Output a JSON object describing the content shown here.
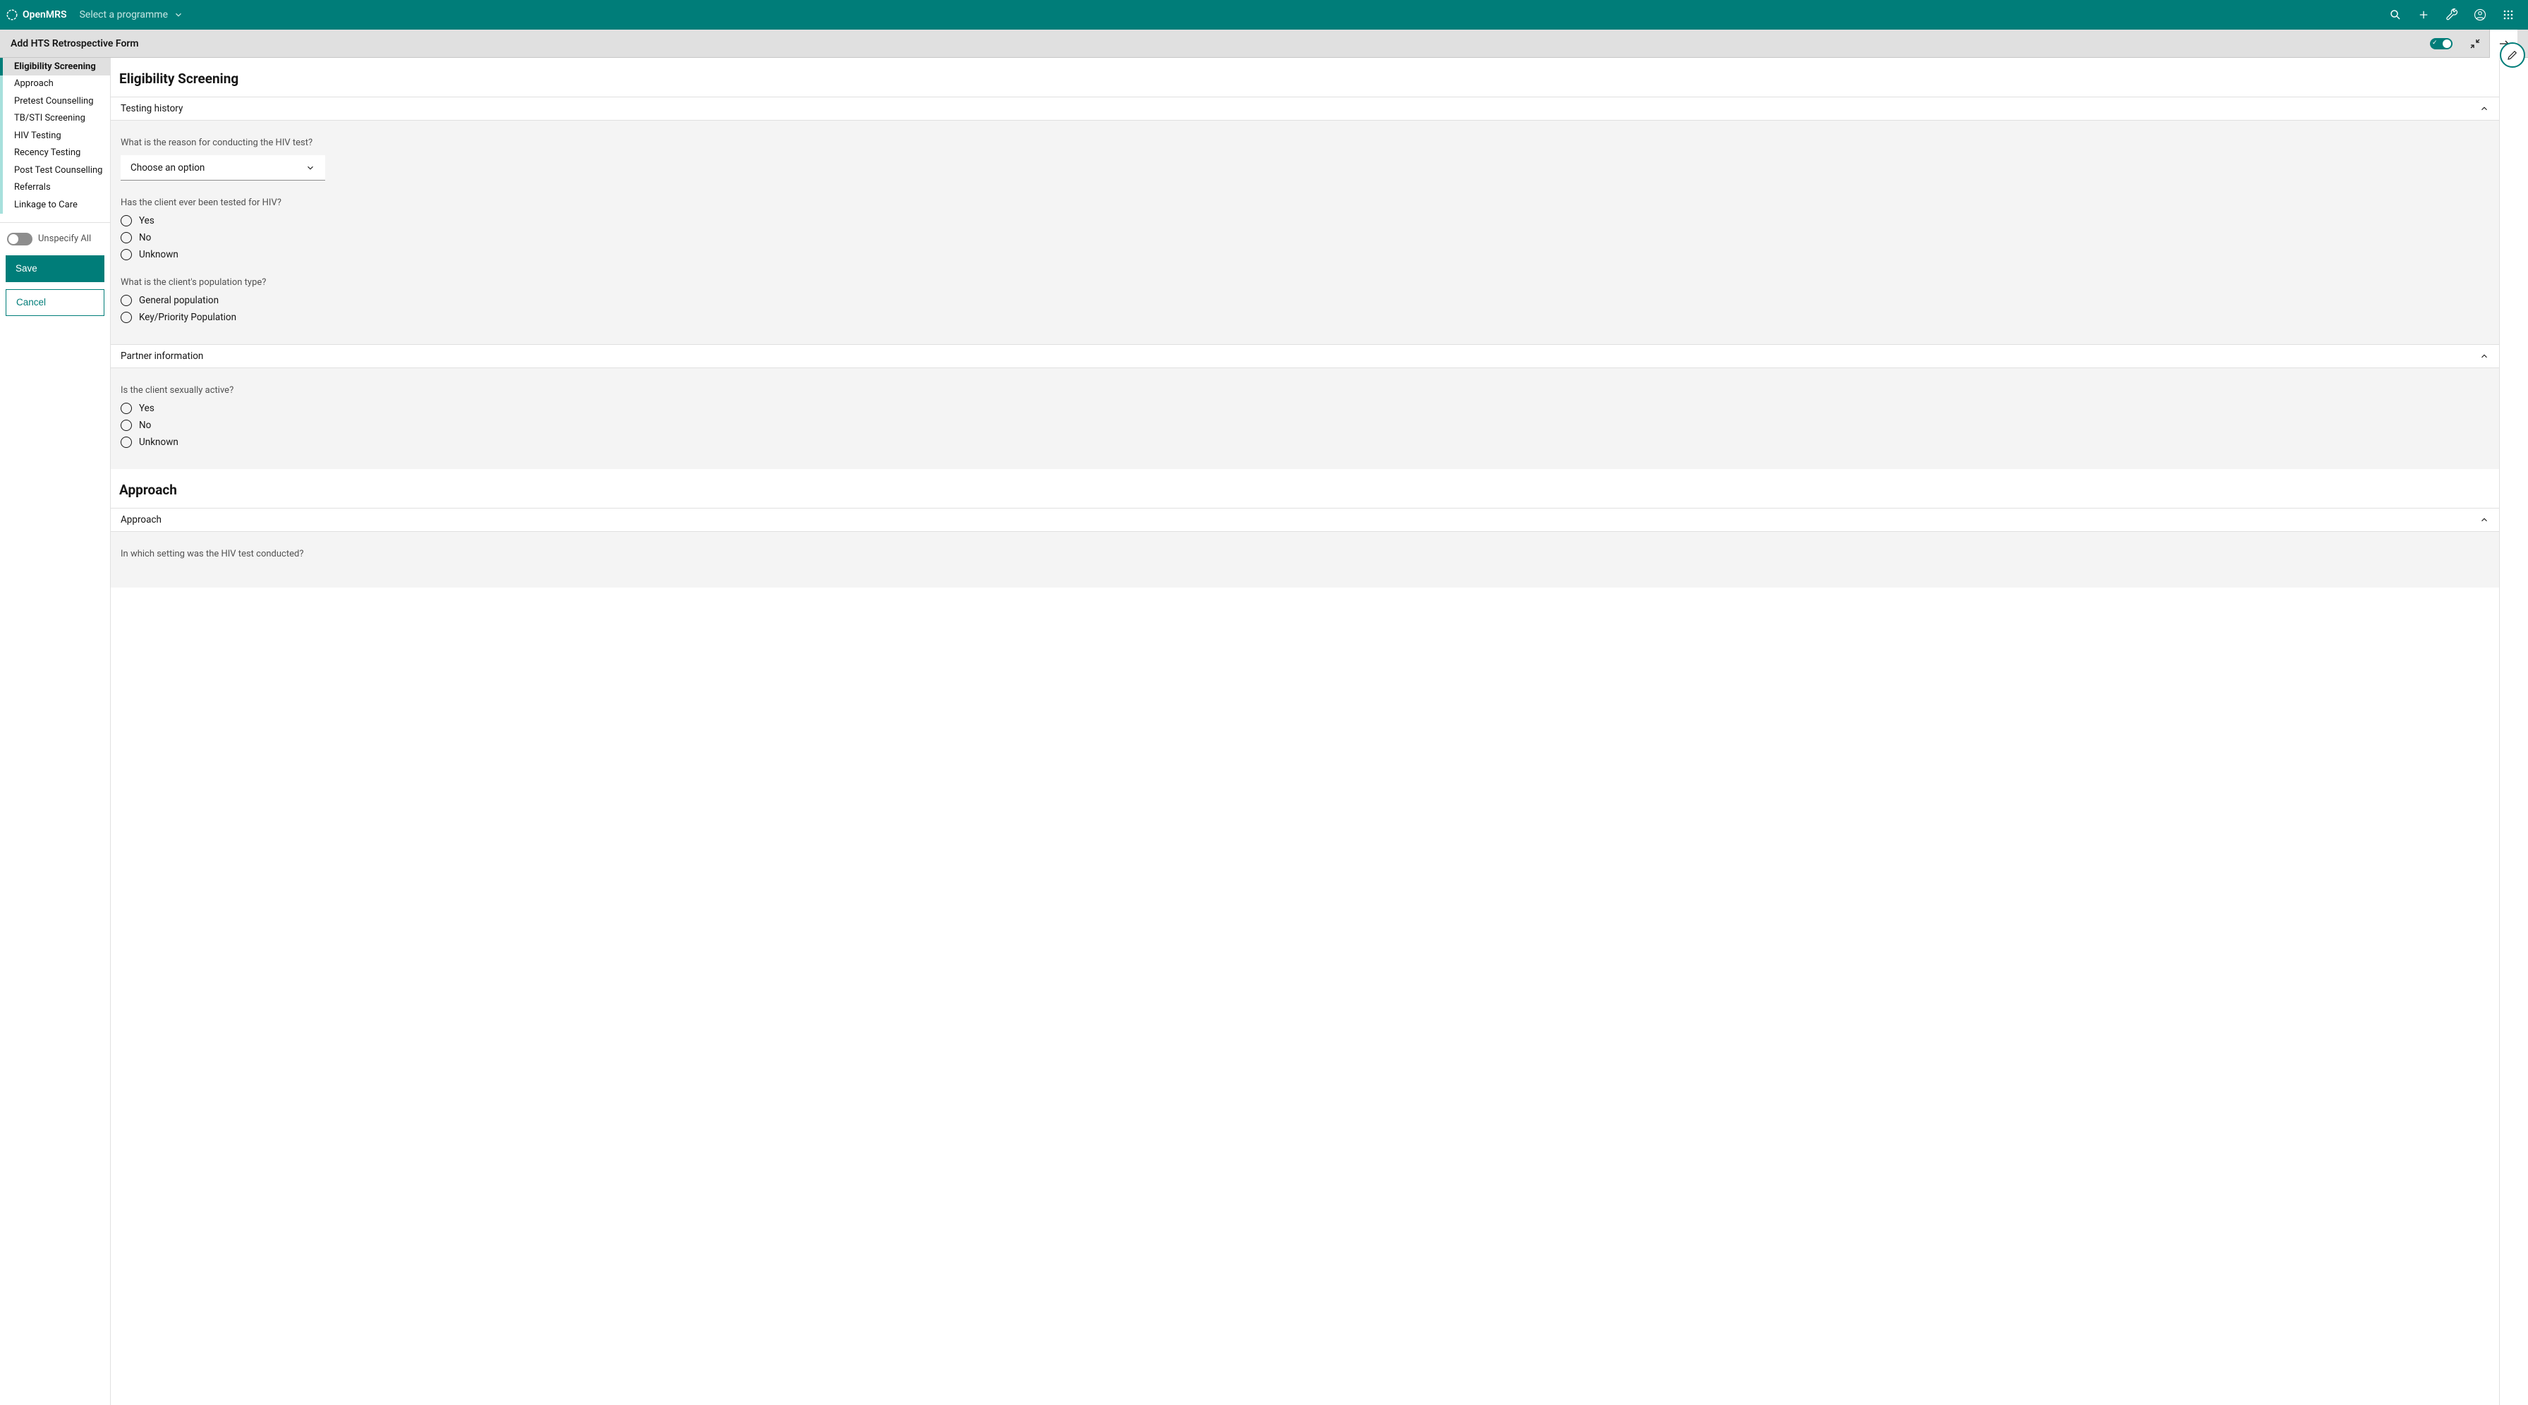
{
  "navbar": {
    "brand": "OpenMRS",
    "programme_label": "Select a programme"
  },
  "form_header": {
    "title": "Add HTS Retrospective Form"
  },
  "sidebar": {
    "items": [
      {
        "label": "Eligibility Screening",
        "active": true
      },
      {
        "label": "Approach"
      },
      {
        "label": "Pretest Counselling"
      },
      {
        "label": "TB/STI Screening"
      },
      {
        "label": "HIV Testing"
      },
      {
        "label": "Recency Testing"
      },
      {
        "label": "Post Test Counselling"
      },
      {
        "label": "Referrals"
      },
      {
        "label": "Linkage to Care"
      }
    ],
    "unspecify_label": "Unspecify All",
    "save_label": "Save",
    "cancel_label": "Cancel"
  },
  "sections": {
    "eligibility": {
      "title": "Eligibility Screening",
      "groups": {
        "testing_history": {
          "header": "Testing history",
          "q_reason": {
            "label": "What is the reason for conducting the HIV test?",
            "placeholder": "Choose an option"
          },
          "q_tested": {
            "label": "Has the client ever been tested for HIV?",
            "opts": [
              "Yes",
              "No",
              "Unknown"
            ]
          },
          "q_pop": {
            "label": "What is the client's population type?",
            "opts": [
              "General population",
              "Key/Priority Population"
            ]
          }
        },
        "partner_info": {
          "header": "Partner information",
          "q_active": {
            "label": "Is the client sexually active?",
            "opts": [
              "Yes",
              "No",
              "Unknown"
            ]
          }
        }
      }
    },
    "approach": {
      "title": "Approach",
      "groups": {
        "approach_g": {
          "header": "Approach",
          "q_setting": {
            "label": "In which setting was the HIV test conducted?"
          }
        }
      }
    }
  }
}
